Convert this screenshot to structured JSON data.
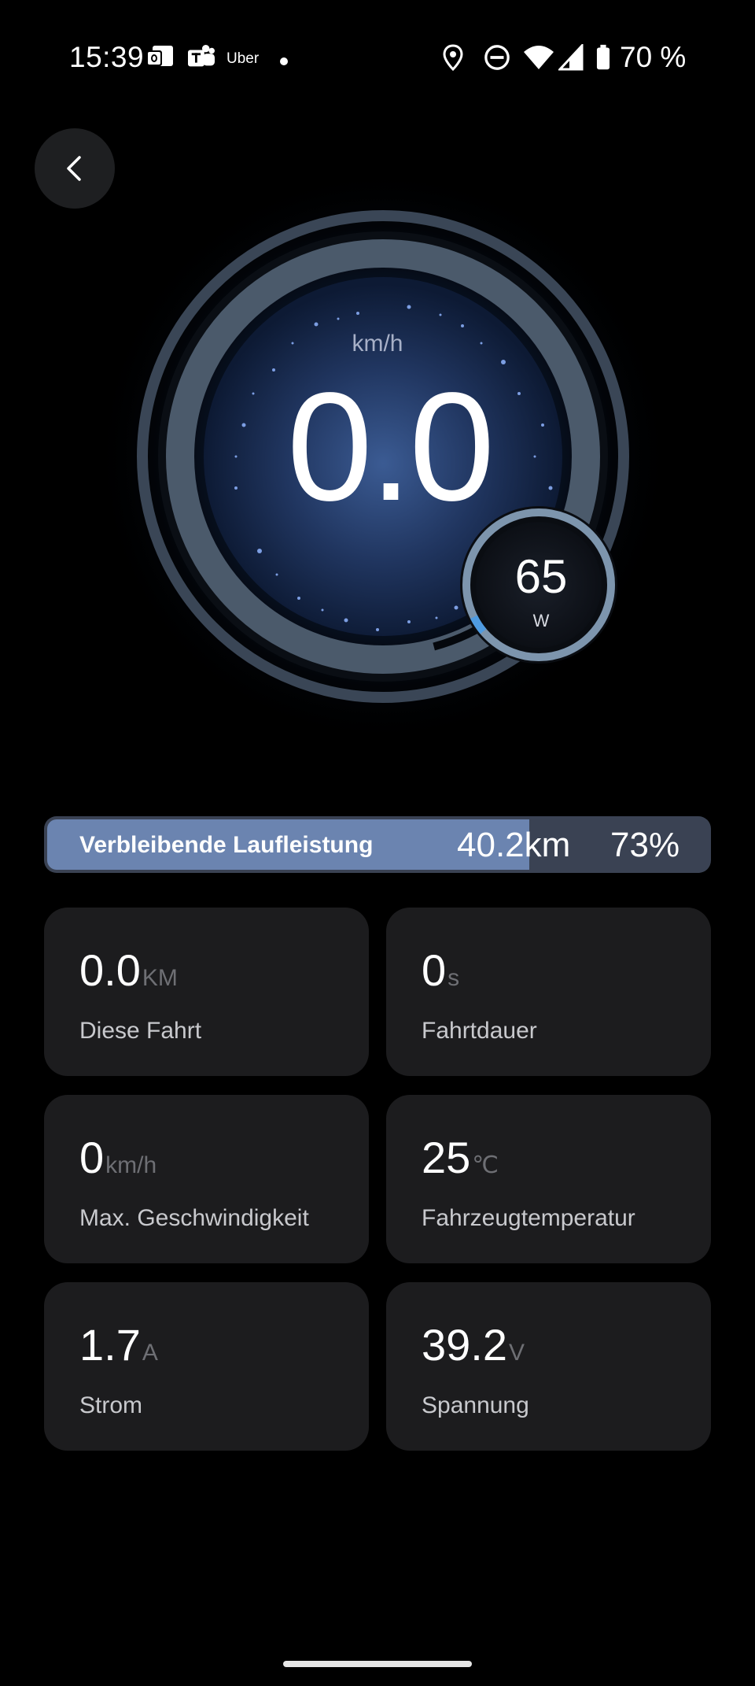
{
  "status_bar": {
    "time": "15:39",
    "app_label": "Uber",
    "battery_percent": "70 %",
    "icons": [
      "outlook-icon",
      "teams-icon",
      "uber-icon",
      "notification-dot",
      "location-icon",
      "do-not-disturb-icon",
      "wifi-icon",
      "cell-signal-icon",
      "battery-icon"
    ]
  },
  "header": {
    "back_icon": "chevron-left-icon"
  },
  "speedometer": {
    "unit": "km/h",
    "speed": "0.0",
    "power_value": "65",
    "power_unit": "W"
  },
  "range": {
    "label": "Verbleibende Laufleistung",
    "distance": "40.2km",
    "percent_text": "73%",
    "percent": 73
  },
  "stats": [
    {
      "value": "0.0",
      "unit": "KM",
      "label": "Diese Fahrt"
    },
    {
      "value": "0",
      "unit": "s",
      "label": "Fahrtdauer"
    },
    {
      "value": "0",
      "unit": "km/h",
      "label": "Max. Geschwindigkeit"
    },
    {
      "value": "25",
      "unit": "℃",
      "label": "Fahrzeugtemperatur"
    },
    {
      "value": "1.7",
      "unit": "A",
      "label": "Strom"
    },
    {
      "value": "39.2",
      "unit": "V",
      "label": "Spannung"
    }
  ],
  "colors": {
    "background": "#000000",
    "card": "#1c1c1e",
    "range_fill": "#6b84b0",
    "range_track": "#3a4253",
    "gauge_ring": "#4b5a6b"
  }
}
